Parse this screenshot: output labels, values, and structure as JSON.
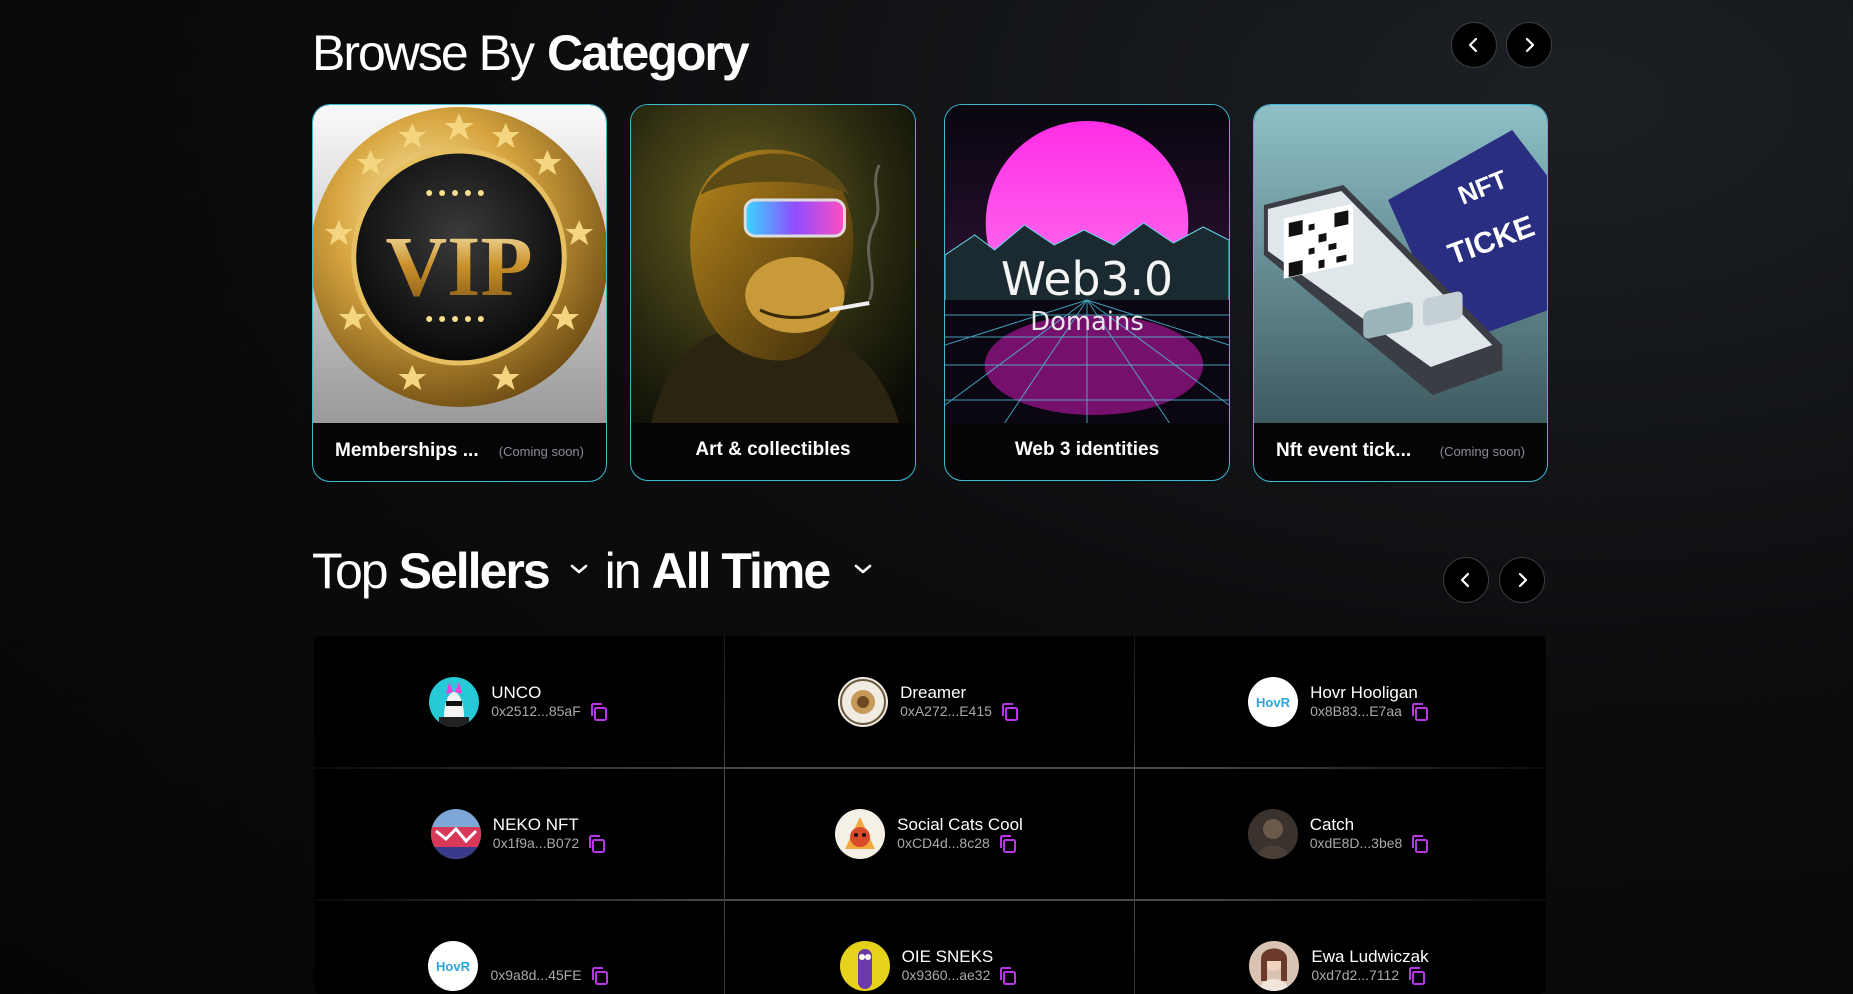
{
  "browse": {
    "title_light": "Browse By",
    "title_bold": "Category",
    "prev_label": "‹",
    "next_label": "›",
    "categories": [
      {
        "label": "Memberships ...",
        "badge": "(Coming soon)",
        "image": "vip-coin-image"
      },
      {
        "label": "Art & collectibles",
        "badge": "",
        "image": "ape-art-image"
      },
      {
        "label": "Web 3 identities",
        "badge": "",
        "image": "web3-domains-image"
      },
      {
        "label": "Nft event tick...",
        "badge": "(Coming soon)",
        "image": "event-ticket-image"
      }
    ],
    "web3_image_text": "Web3.0",
    "web3_image_subtext": "Domains",
    "ticket_image_text": "TICKE",
    "ticket_image_text2": "NFT"
  },
  "sellers": {
    "title_light": "Top",
    "title_bold": "Sellers",
    "in_label": "in",
    "period_bold": "All Time",
    "sellers": [
      {
        "name": "UNCO",
        "address": "0x2512...85aF"
      },
      {
        "name": "Dreamer",
        "address": "0xA272...E415"
      },
      {
        "name": "Hovr Hooligan",
        "address": "0x8B83...E7aa"
      },
      {
        "name": "NEKO NFT",
        "address": "0x1f9a...B072"
      },
      {
        "name": "Social Cats Cool",
        "address": "0xCD4d...8c28"
      },
      {
        "name": "Catch",
        "address": "0xdE8D...3be8"
      },
      {
        "name": "",
        "address": "0x9a8d...45FE"
      },
      {
        "name": "OIE SNEKS",
        "address": "0x9360...ae32"
      },
      {
        "name": "Ewa Ludwiczak",
        "address": "0xd7d2...7112"
      }
    ],
    "hovr_logo_text": "HovR"
  },
  "colors": {
    "accent_border": "#3fb8d2",
    "copy_icon": "#b935e8",
    "background": "#0c0d0f"
  }
}
